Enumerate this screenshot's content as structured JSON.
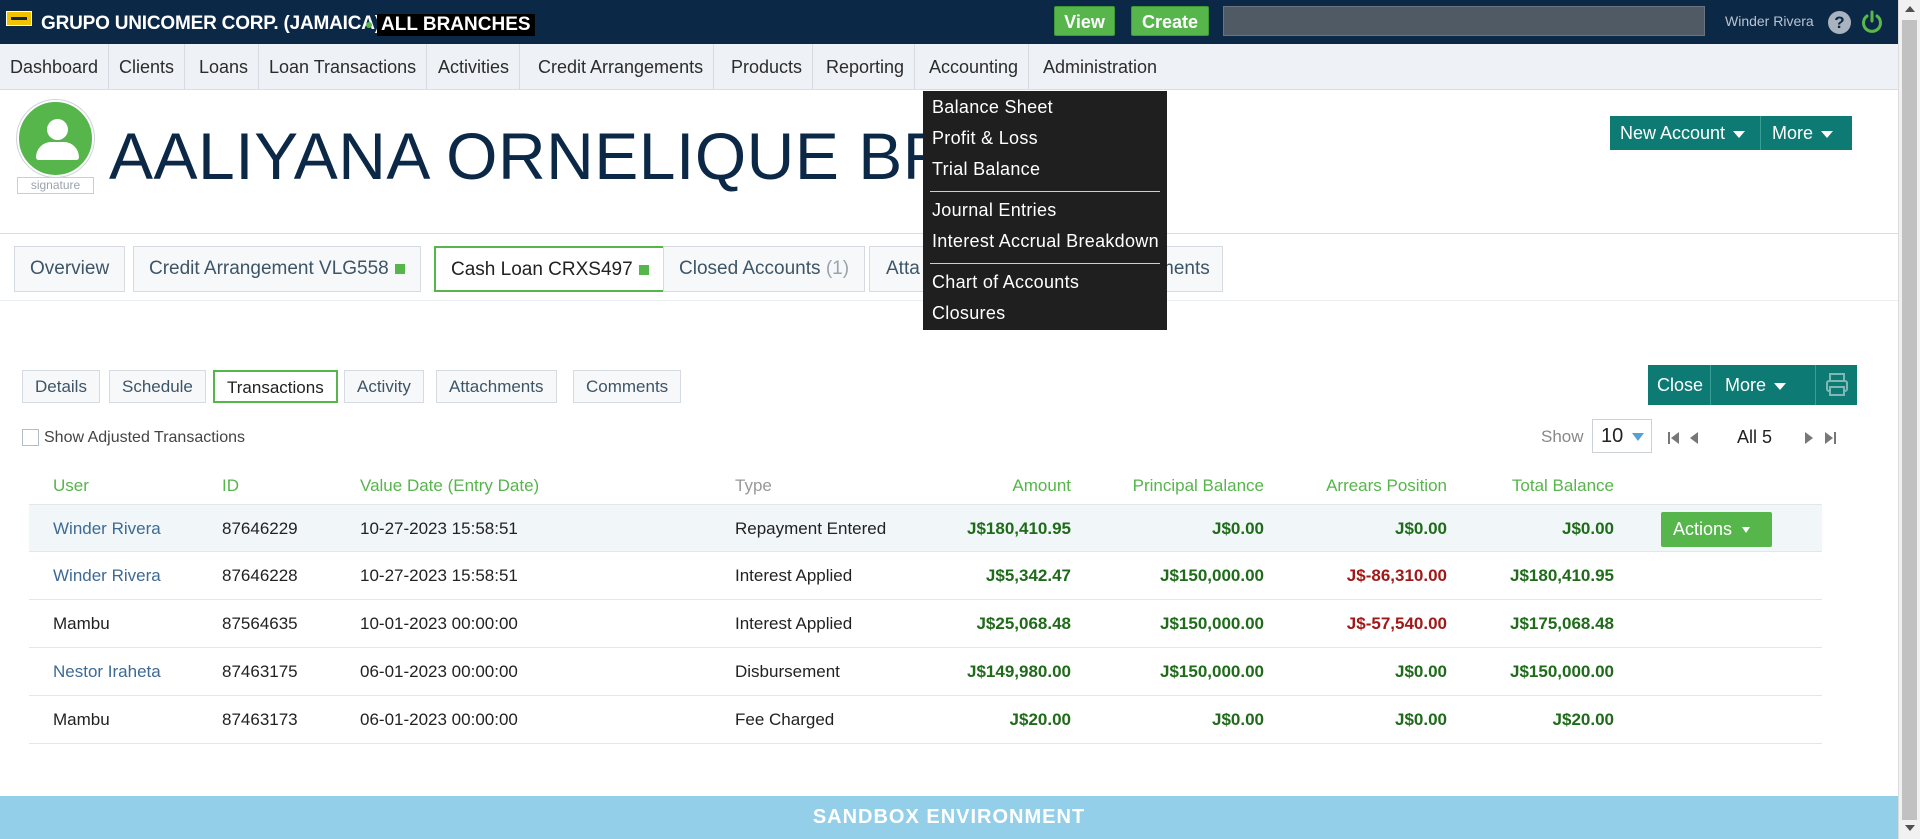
{
  "topbar": {
    "org": "GRUPO UNICOMER CORP. (JAMAICA)",
    "branch": "ALL BRANCHES",
    "view_label": "View",
    "create_label": "Create",
    "search_value": "",
    "username": "Winder Rivera",
    "help_icon": "help-icon",
    "power_icon": "power-icon"
  },
  "nav": {
    "items": [
      "Dashboard",
      "Clients",
      "Loans",
      "Loan Transactions",
      "Activities",
      "Credit Arrangements",
      "Products",
      "Reporting",
      "Accounting",
      "Administration"
    ]
  },
  "accounting_menu": {
    "items": [
      "Balance Sheet",
      "Profit & Loss",
      "Trial Balance",
      "Journal Entries",
      "Interest Accrual Breakdown",
      "Chart of Accounts",
      "Closures"
    ]
  },
  "client": {
    "name": "AALIYANA ORNELIQUE BRO",
    "signature_label": "signature",
    "new_account_label": "New Account",
    "more_label": "More"
  },
  "account_tabs": [
    {
      "label": "Overview"
    },
    {
      "label": "Credit Arrangement VLG558"
    },
    {
      "label": "Cash Loan CRXS497"
    },
    {
      "label": "Closed Accounts",
      "count": "(1)"
    },
    {
      "label": "Atta"
    },
    {
      "label": "ments"
    }
  ],
  "sub_tabs": [
    "Details",
    "Schedule",
    "Transactions",
    "Activity",
    "Attachments",
    "Comments"
  ],
  "tx_toolbar": {
    "close_label": "Close",
    "more_label": "More",
    "print_icon": "printer-icon"
  },
  "options": {
    "show_adjusted_label": "Show Adjusted Transactions",
    "show_adjusted_checked": false,
    "show_label": "Show",
    "page_size": "10",
    "all_label": "All 5"
  },
  "table": {
    "headers": [
      "User",
      "ID",
      "Value Date (Entry Date)",
      "Type",
      "Amount",
      "Principal Balance",
      "Arrears Position",
      "Total Balance"
    ],
    "actions_label": "Actions",
    "rows": [
      {
        "user": "Winder Rivera",
        "id": "87646229",
        "date": "10-27-2023 15:58:51",
        "type": "Repayment Entered",
        "amount": "J$180,410.95",
        "principal": "J$0.00",
        "arrears": "J$0.00",
        "total": "J$0.00"
      },
      {
        "user": "Winder Rivera",
        "id": "87646228",
        "date": "10-27-2023 15:58:51",
        "type": "Interest Applied",
        "amount": "J$5,342.47",
        "principal": "J$150,000.00",
        "arrears": "J$-86,310.00",
        "total": "J$180,410.95"
      },
      {
        "user": "Mambu",
        "id": "87564635",
        "date": "10-01-2023 00:00:00",
        "type": "Interest Applied",
        "amount": "J$25,068.48",
        "principal": "J$150,000.00",
        "arrears": "J$-57,540.00",
        "total": "J$175,068.48"
      },
      {
        "user": "Nestor Iraheta",
        "id": "87463175",
        "date": "06-01-2023 00:00:00",
        "type": "Disbursement",
        "amount": "J$149,980.00",
        "principal": "J$150,000.00",
        "arrears": "J$0.00",
        "total": "J$150,000.00"
      },
      {
        "user": "Mambu",
        "id": "87463173",
        "date": "06-01-2023 00:00:00",
        "type": "Fee Charged",
        "amount": "J$20.00",
        "principal": "J$0.00",
        "arrears": "J$0.00",
        "total": "J$20.00"
      }
    ]
  },
  "footer": {
    "sandbox_label": "SANDBOX ENVIRONMENT"
  },
  "colors": {
    "topbar": "#0c2847",
    "green": "#56b54b",
    "teal": "#0d7a73",
    "negative": "#a01919",
    "positive": "#1f6b1a",
    "sandbox": "#93cfe9"
  }
}
